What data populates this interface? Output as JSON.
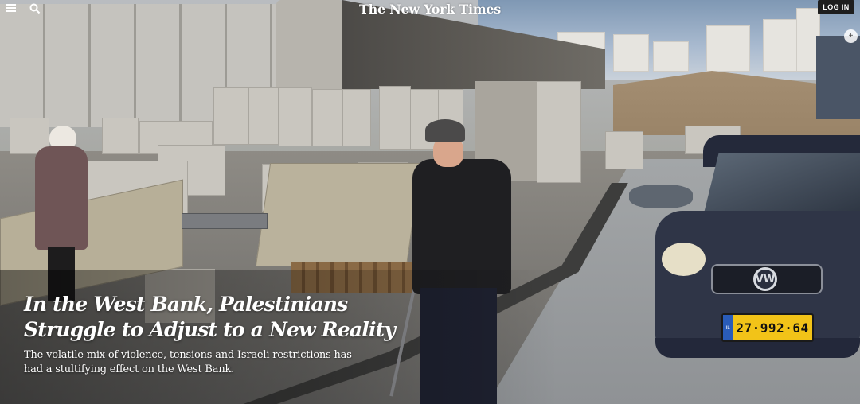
{
  "header": {
    "logo_text": "The New York Times",
    "login_label": "LOG IN",
    "menu_icon": "hamburger-menu-icon",
    "search_icon": "search-icon"
  },
  "article": {
    "headline": "In the West Bank, Palestinians Struggle to Adjust to a New Reality",
    "summary": "The volatile mix of violence, tensions and Israeli restrictions has had a stultifying effect on the West Bank."
  },
  "photo": {
    "license_plate": "27·992·64",
    "plate_country": "IL",
    "car_badge": "VW"
  },
  "colors": {
    "login_bg": "#1e1e1e",
    "text": "#ffffff",
    "plate_yellow": "#f2c318"
  }
}
